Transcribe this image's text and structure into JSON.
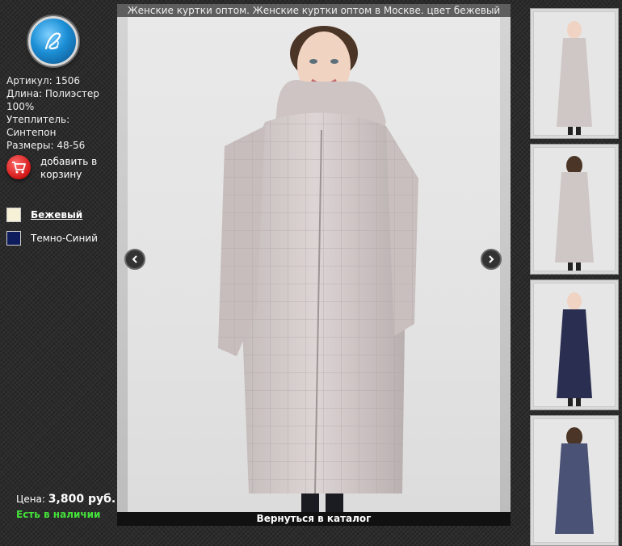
{
  "product": {
    "title": "Женские куртки оптом. Женские куртки оптом в Москве. цвет бежевый",
    "specs": {
      "article": "Артикул: 1506",
      "length": "Длина: Полиэстер 100%",
      "insulation": "Утеплитель: Синтепон",
      "sizes": "Размеры: 48-56"
    },
    "cart_label": "добавить в корзину",
    "colors": [
      {
        "name": "Бежевый",
        "hex": "#f5f0d6",
        "active": true
      },
      {
        "name": "Темно-Синий",
        "hex": "#0e1b5c",
        "active": false
      }
    ],
    "price_label": "Цена:",
    "price_value": "3,800 руб.",
    "stock": "Есть в наличии",
    "back_to_catalog": "Вернуться в каталог"
  },
  "thumbnails": [
    {
      "icon": "beige-coat-front",
      "color": "#cfc7c6"
    },
    {
      "icon": "beige-coat-back",
      "color": "#cfc7c6"
    },
    {
      "icon": "navy-coat-front",
      "color": "#2a2f52"
    },
    {
      "icon": "navy-coat-back",
      "color": "#4a5276"
    }
  ],
  "colors": {
    "accent_green": "#44e03a",
    "cart_red": "#d11616"
  }
}
